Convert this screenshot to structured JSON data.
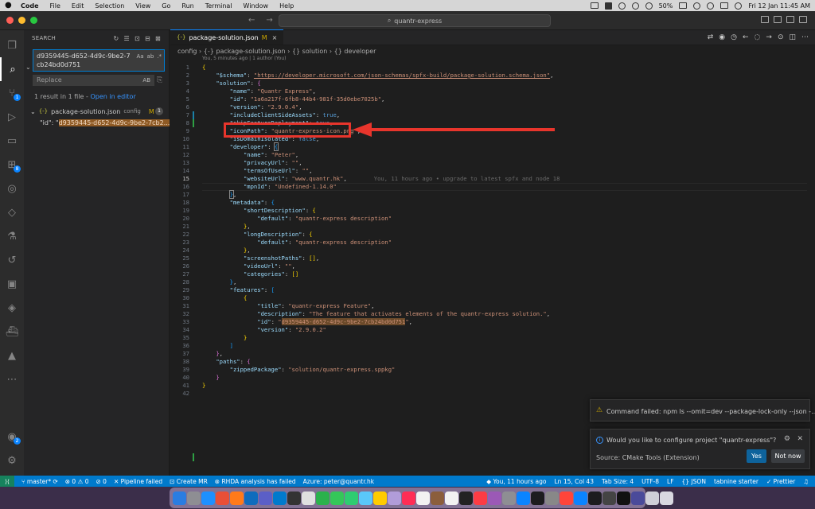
{
  "menubar": {
    "app": "Code",
    "items": [
      "File",
      "Edit",
      "Selection",
      "View",
      "Go",
      "Run",
      "Terminal",
      "Window",
      "Help"
    ],
    "battery": "50%",
    "datetime": "Fri 12 Jan  11:45 AM"
  },
  "titlebar": {
    "command_center": "quantr-express"
  },
  "sidebar": {
    "title": "SEARCH",
    "search_value": "d9359445-d652-4d9c-9be2-7cb24bd0d751",
    "search_opts": [
      "Aa",
      "ab",
      ".*"
    ],
    "replace_placeholder": "Replace",
    "replace_opt": "AB",
    "result_info": "1 result in 1 file - ",
    "open_in_editor": "Open in editor",
    "file": {
      "name": "package-solution.json",
      "folder": "config",
      "status": "M",
      "count": "1"
    },
    "match": {
      "prefix": "\"id\": \"",
      "highlight": "d9359445-d652-4d9c-9be2-7cb2..."
    }
  },
  "activitybar": {
    "source_control_badge": "1",
    "extensions_badge": "8",
    "account_badge": "2"
  },
  "editor": {
    "tab": {
      "name": "package-solution.json",
      "status": "M",
      "close": "×"
    },
    "breadcrumb": [
      "config",
      "{-} package-solution.json",
      "{} solution",
      "{} developer"
    ],
    "blame_header": "You, 5 minutes ago | 1 author (You)",
    "inline_blame": "You, 11 hours ago • upgrade to latest spfx and node 18",
    "lines": {
      "l2_key": "\"$schema\"",
      "l2_val": "\"https://developer.microsoft.com/json-schemas/spfx-build/package-solution.schema.json\"",
      "l3_key": "\"solution\"",
      "l4_key": "\"name\"",
      "l4_val": "\"Quantr Express\"",
      "l5_key": "\"id\"",
      "l5_val": "\"1a6a217f-6fb8-44b4-981f-35d0ebe7025b\"",
      "l6_key": "\"version\"",
      "l6_val": "\"2.9.0.4\"",
      "l7_key": "\"includeClientSideAssets\"",
      "l7_val": "true",
      "l8_key": "\"skipFeatureDeployment\"",
      "l8_val": "true",
      "l9_key": "\"iconPath\"",
      "l9_val": "\"quantr-express-icon.png\"",
      "l10_key": "\"isDomainIsolated\"",
      "l10_val": "false",
      "l11_key": "\"developer\"",
      "l12_key": "\"name\"",
      "l12_val": "\"Peter\"",
      "l13_key": "\"privacyUrl\"",
      "l13_val": "\"\"",
      "l14_key": "\"termsOfUseUrl\"",
      "l14_val": "\"\"",
      "l15_key": "\"websiteUrl\"",
      "l15_val": "\"www.quantr.hk\"",
      "l16_key": "\"mpnId\"",
      "l16_val": "\"Undefined-1.14.0\"",
      "l18_key": "\"metadata\"",
      "l19_key": "\"shortDescription\"",
      "l20_key": "\"default\"",
      "l20_val": "\"quantr-express description\"",
      "l22_key": "\"longDescription\"",
      "l23_key": "\"default\"",
      "l23_val": "\"quantr-express description\"",
      "l25_key": "\"screenshotPaths\"",
      "l26_key": "\"videoUrl\"",
      "l26_val": "\"\"",
      "l27_key": "\"categories\"",
      "l29_key": "\"features\"",
      "l31_key": "\"title\"",
      "l31_val": "\"quantr-express Feature\"",
      "l32_key": "\"description\"",
      "l32_val": "\"The feature that activates elements of the quantr-express solution.\"",
      "l33_key": "\"id\"",
      "l33_val": "d9359445-d652-4d9c-9be2-7cb24bd0d751",
      "l34_key": "\"version\"",
      "l34_val": "\"2.9.0.2\"",
      "l38_key": "\"paths\"",
      "l39_key": "\"zippedPackage\"",
      "l39_val": "\"solution/quantr-express.sppkg\""
    }
  },
  "notifications": {
    "error_text": "Command failed: npm ls --omit=dev --package-lock-only --json -...",
    "cmake_question": "Would you like to configure project \"quantr-express\"?",
    "cmake_source": "Source: CMake Tools (Extension)",
    "yes": "Yes",
    "not_now": "Not now"
  },
  "statusbar": {
    "branch": "master*",
    "problems": "⊗ 0 ⚠ 0",
    "ports": "⊘ 0",
    "pipeline": "✕ Pipeline failed",
    "create_mr": "Create MR",
    "rhda": "RHDA analysis has failed",
    "azure": "Azure: peter@quantr.hk",
    "blame": "You, 11 hours ago",
    "position": "Ln 15, Col 43",
    "tab_size": "Tab Size: 4",
    "encoding": "UTF-8",
    "eol": "LF",
    "language": "{} JSON",
    "tabnine": "tabnine starter",
    "prettier": "✓ Prettier"
  },
  "colors": {
    "accent": "#007acc",
    "annotation": "#e8352c",
    "remote": "#16825d"
  }
}
